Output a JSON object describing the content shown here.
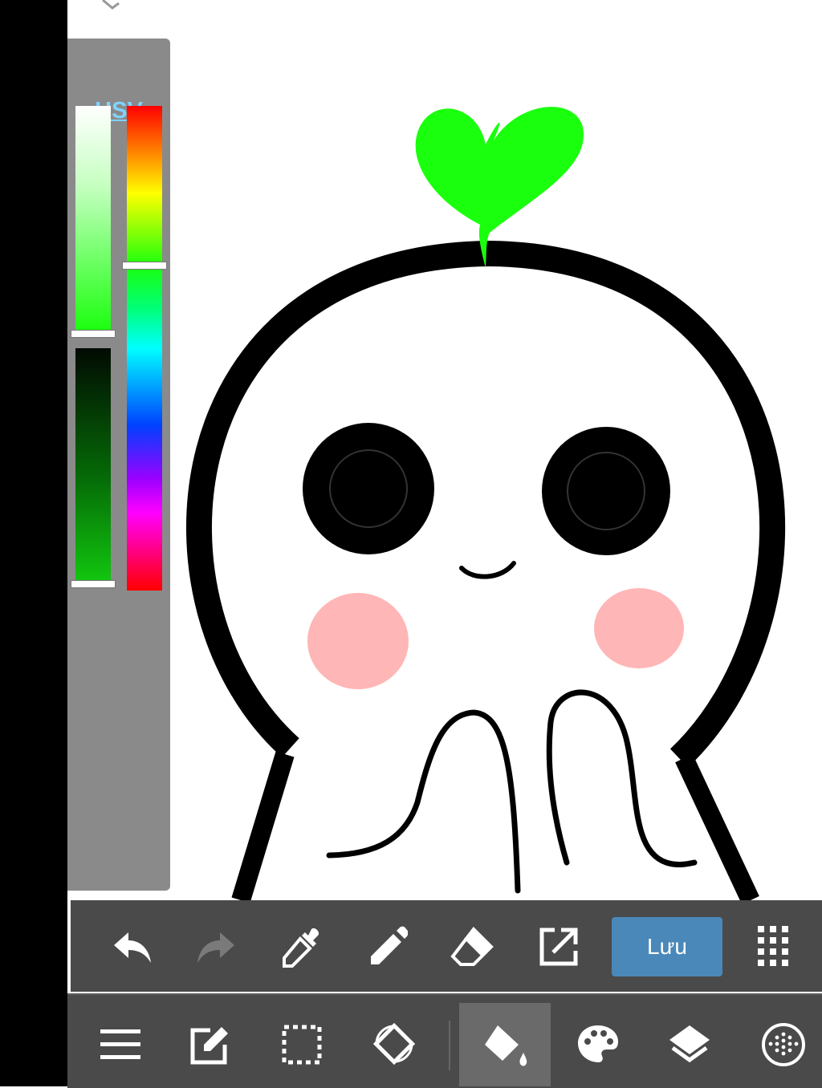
{
  "color_panel": {
    "mode_label": "HSV",
    "current_color": "#1aff0e"
  },
  "toolbar": {
    "save_label": "Lưu",
    "icons_top": [
      "undo-icon",
      "redo-icon",
      "eyedropper-icon",
      "pencil-icon",
      "eraser-icon",
      "open-external-icon",
      "grid-menu-icon"
    ],
    "icons_bottom": [
      "menu-icon",
      "edit-icon",
      "selection-icon",
      "rotate-icon",
      "fill-bucket-icon",
      "palette-icon",
      "layers-icon",
      "brush-dot-icon"
    ],
    "active_tool": "fill-bucket-icon"
  },
  "colors": {
    "toolbar_bg": "#4a4a4a",
    "save_button": "#4a88b9",
    "sprout_green": "#1aff0e",
    "cheek_pink": "#ffb6b6",
    "panel_bg": "#8a8a8a"
  }
}
